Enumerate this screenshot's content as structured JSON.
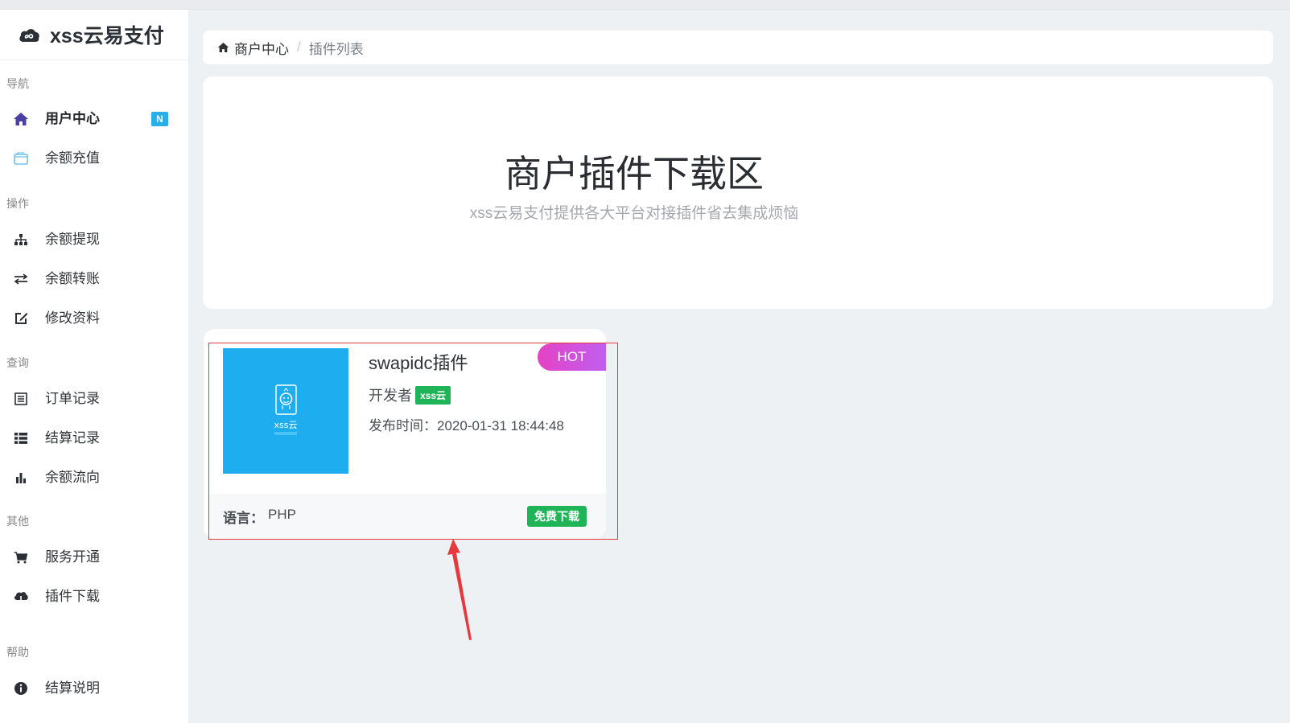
{
  "app": {
    "brand_name": "xss云易支付"
  },
  "sidebar": {
    "sections": [
      {
        "label": "导航"
      },
      {
        "label": "操作"
      },
      {
        "label": "查询"
      },
      {
        "label": "其他"
      },
      {
        "label": "帮助"
      }
    ],
    "items": [
      {
        "label": "用户中心",
        "icon": "home-icon",
        "badge": "N"
      },
      {
        "label": "余额充值",
        "icon": "wallet-icon"
      },
      {
        "label": "余额提现",
        "icon": "sitemap-icon"
      },
      {
        "label": "余额转账",
        "icon": "exchange-icon"
      },
      {
        "label": "修改资料",
        "icon": "edit-icon"
      },
      {
        "label": "订单记录",
        "icon": "list-alt-icon"
      },
      {
        "label": "结算记录",
        "icon": "list-icon"
      },
      {
        "label": "余额流向",
        "icon": "bar-chart-icon"
      },
      {
        "label": "服务开通",
        "icon": "cart-icon"
      },
      {
        "label": "插件下载",
        "icon": "cloud-download-icon"
      },
      {
        "label": "结算说明",
        "icon": "info-icon"
      }
    ]
  },
  "breadcrumb": {
    "home": "商户中心",
    "separator": "/",
    "current": "插件列表"
  },
  "hero": {
    "title": "商户插件下载区",
    "subtitle": "xss云易支付提供各大平台对接插件省去集成烦恼"
  },
  "plugin": {
    "name": "swapidc插件",
    "developer_label": "开发者",
    "developer_tag": "xss云",
    "release_label": "发布时间：",
    "release_time": "2020-01-31 18:44:48",
    "hot_badge": "HOT",
    "lang_label": "语言：",
    "lang_value": "PHP",
    "download_label": "免费下载",
    "thumb_text": "xss云"
  },
  "colors": {
    "accent_blue": "#1eaef0",
    "green": "#1fb457",
    "badge_blue": "#2aaee6",
    "annotation_red": "#e6393d"
  }
}
